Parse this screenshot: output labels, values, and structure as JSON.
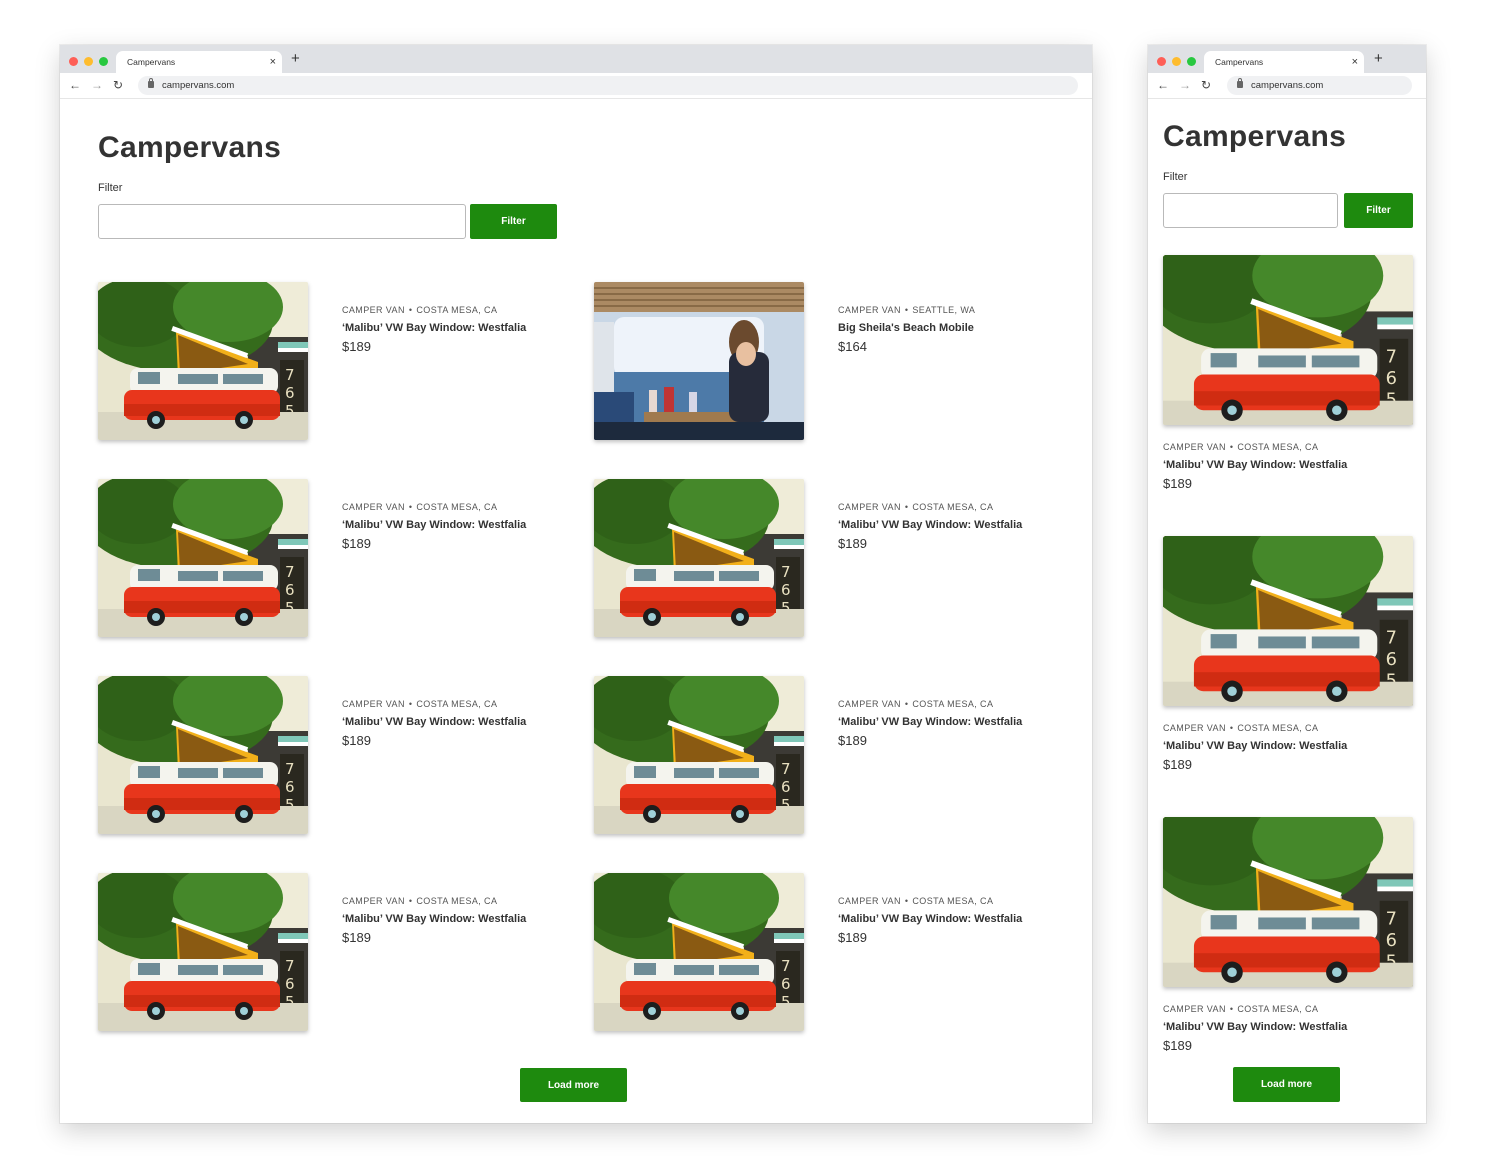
{
  "browser": {
    "tab_title": "Campervans",
    "close_glyph": "×",
    "new_tab_glyph": "+",
    "url": "campervans.com",
    "back_glyph": "←",
    "forward_glyph": "→",
    "reload_glyph": "↻"
  },
  "page": {
    "title": "Campervans",
    "filter_label": "Filter",
    "filter_value": "",
    "filter_button": "Filter",
    "load_more": "Load more"
  },
  "listings": [
    {
      "type": "Camper van",
      "location": "Costa Mesa, CA",
      "name": "‘Malibu’ VW Bay Window: Westfalia",
      "price": "$189",
      "image": "orange-vw-van"
    },
    {
      "type": "Camper van",
      "location": "Seattle, WA",
      "name": "Big Sheila's Beach Mobile",
      "price": "$164",
      "image": "van-interior-ocean"
    },
    {
      "type": "Camper van",
      "location": "Costa Mesa, CA",
      "name": "‘Malibu’ VW Bay Window: Westfalia",
      "price": "$189",
      "image": "orange-vw-van"
    },
    {
      "type": "Camper van",
      "location": "Costa Mesa, CA",
      "name": "‘Malibu’ VW Bay Window: Westfalia",
      "price": "$189",
      "image": "orange-vw-van"
    },
    {
      "type": "Camper van",
      "location": "Costa Mesa, CA",
      "name": "‘Malibu’ VW Bay Window: Westfalia",
      "price": "$189",
      "image": "orange-vw-van"
    },
    {
      "type": "Camper van",
      "location": "Costa Mesa, CA",
      "name": "‘Malibu’ VW Bay Window: Westfalia",
      "price": "$189",
      "image": "orange-vw-van"
    },
    {
      "type": "Camper van",
      "location": "Costa Mesa, CA",
      "name": "‘Malibu’ VW Bay Window: Westfalia",
      "price": "$189",
      "image": "orange-vw-van"
    },
    {
      "type": "Camper van",
      "location": "Costa Mesa, CA",
      "name": "‘Malibu’ VW Bay Window: Westfalia",
      "price": "$189",
      "image": "orange-vw-van"
    }
  ],
  "mobile_listings": [
    {
      "type": "Camper van",
      "location": "Costa Mesa, CA",
      "name": "‘Malibu’ VW Bay Window: Westfalia",
      "price": "$189",
      "image": "orange-vw-van"
    },
    {
      "type": "Camper van",
      "location": "Costa Mesa, CA",
      "name": "‘Malibu’ VW Bay Window: Westfalia",
      "price": "$189",
      "image": "orange-vw-van"
    },
    {
      "type": "Camper van",
      "location": "Costa Mesa, CA",
      "name": "‘Malibu’ VW Bay Window: Westfalia",
      "price": "$189",
      "image": "orange-vw-van"
    }
  ],
  "colors": {
    "accent": "#1e8a0e",
    "van_body": "#e8361c",
    "tree": "#3d7a1e",
    "roof": "#f2b01a"
  },
  "separator_glyph": "•"
}
